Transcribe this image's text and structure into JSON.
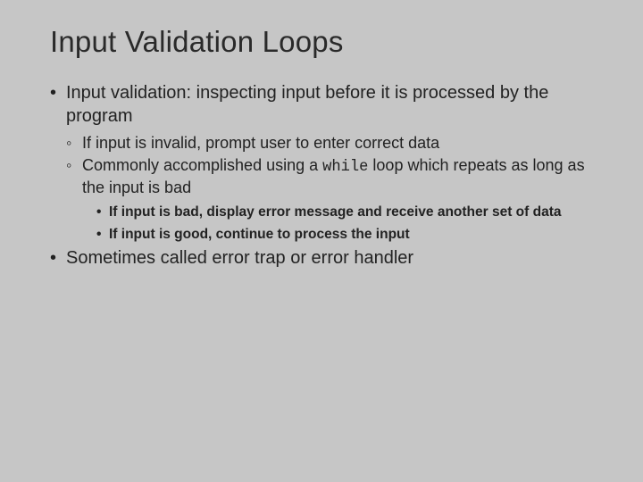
{
  "title": "Input Validation Loops",
  "bullets": {
    "b1": "Input validation: inspecting input before it is processed by the program",
    "b1_1": "If input is invalid, prompt user to enter correct data",
    "b1_2a": "Commonly accomplished using a ",
    "b1_2_code": "while",
    "b1_2b": " loop which repeats as long as the input is bad",
    "b1_2_i": "If input is bad, display error message and receive another set of data",
    "b1_2_ii": "If input is good, continue to process the input",
    "b2": "Sometimes called error trap or error handler"
  }
}
